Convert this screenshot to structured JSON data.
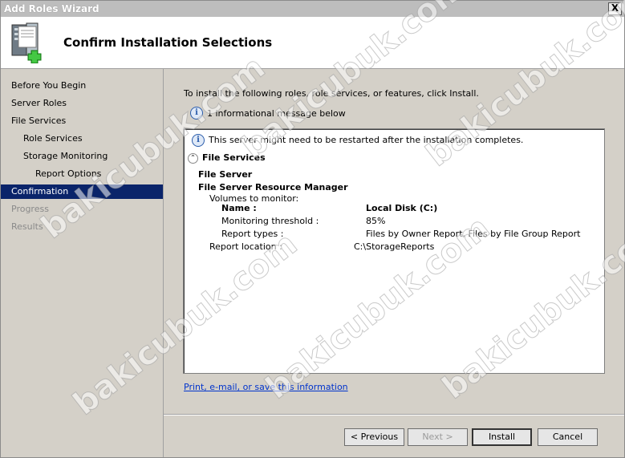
{
  "window": {
    "title": "Add Roles Wizard",
    "close_glyph": "X"
  },
  "header": {
    "title": "Confirm Installation Selections",
    "icon": "server-add-icon"
  },
  "nav": {
    "items": [
      {
        "label": "Before You Begin",
        "state": "normal"
      },
      {
        "label": "Server Roles",
        "state": "normal"
      },
      {
        "label": "File Services",
        "state": "normal"
      },
      {
        "label": "Role Services",
        "state": "normal"
      },
      {
        "label": "Storage Monitoring",
        "state": "normal"
      },
      {
        "label": "Report Options",
        "state": "normal"
      },
      {
        "label": "Confirmation",
        "state": "active"
      },
      {
        "label": "Progress",
        "state": "disabled"
      },
      {
        "label": "Results",
        "state": "disabled"
      }
    ]
  },
  "main": {
    "intro": "To install the following roles, role services, or features, click Install.",
    "info_message": "1 informational message below",
    "panel": {
      "restart_note": "This server might need to be restarted after the installation completes.",
      "section_title": "File Services",
      "file_server": "File Server",
      "fsrm": "File Server Resource Manager",
      "volumes_label": "Volumes to monitor:",
      "name_label": "Name :",
      "name_value": "Local Disk (C:)",
      "threshold_label": "Monitoring threshold :",
      "threshold_value": "85%",
      "report_types_label": "Report types :",
      "report_types_value": "Files by Owner Report, Files by File Group Report",
      "report_location_label": "Report location :",
      "report_location_value": "C:\\StorageReports"
    },
    "link": "Print, e-mail, or save this information"
  },
  "buttons": {
    "previous": "< Previous",
    "next": "Next >",
    "install": "Install",
    "cancel": "Cancel"
  },
  "watermark": "bakicubuk.com",
  "colors": {
    "selection": "#0a246a",
    "link": "#0033cc",
    "chrome": "#d4d0c8"
  }
}
